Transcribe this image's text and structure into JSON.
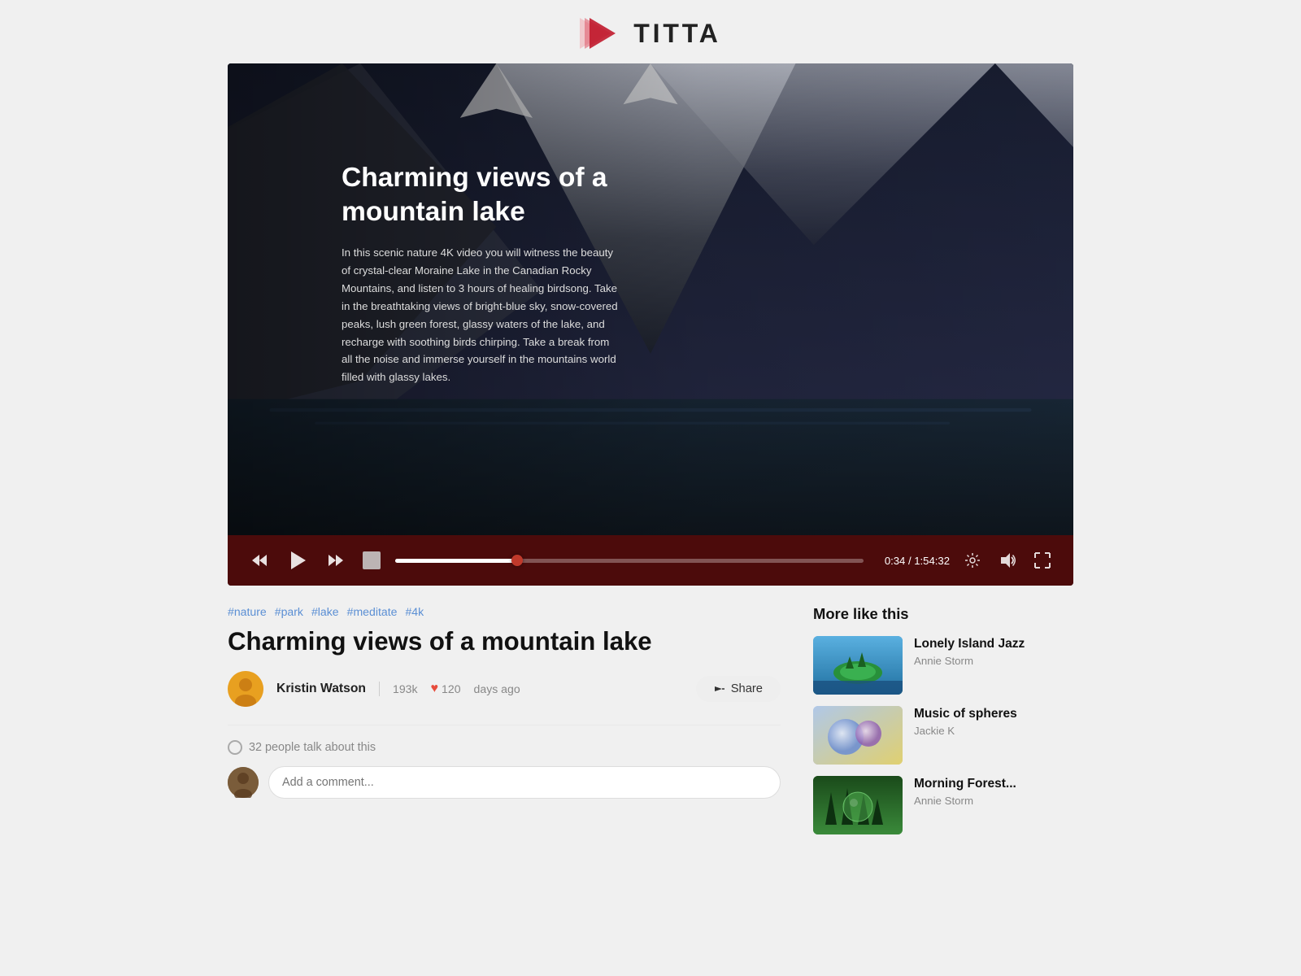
{
  "header": {
    "logo_text": "TITTA"
  },
  "player": {
    "title": "Charming views of a mountain lake",
    "description": "In this scenic nature 4K video you will witness the beauty of crystal-clear Moraine Lake in the Canadian Rocky Mountains, and listen to 3 hours of healing birdsong. Take in the breathtaking views of bright-blue sky, snow-covered peaks, lush green forest, glassy waters of the lake, and recharge with soothing birds chirping. Take a break from all the noise and immerse yourself in the mountains world filled with glassy lakes.",
    "current_time": "0:34",
    "total_time": "1:54:32",
    "time_display": "0:34 / 1:54:32",
    "progress_percent": 26
  },
  "video_meta": {
    "tags": [
      "#nature",
      "#park",
      "#lake",
      "#meditate",
      "#4k"
    ],
    "title": "Charming views of a mountain lake",
    "author": "Kristin Watson",
    "views": "193k",
    "likes": "120",
    "days_ago": "days ago",
    "share_label": "Share"
  },
  "comments": {
    "count_text": "32 people talk about this",
    "placeholder": "Add a comment..."
  },
  "sidebar": {
    "section_title": "More like this",
    "items": [
      {
        "title": "Lonely Island Jazz",
        "author": "Annie Storm",
        "thumb_type": "island"
      },
      {
        "title": "Music of spheres",
        "author": "Jackie K",
        "thumb_type": "spheres"
      },
      {
        "title": "Morning Forest...",
        "author": "Annie Storm",
        "thumb_type": "forest"
      }
    ]
  },
  "icons": {
    "rewind": "⏮",
    "play": "▶",
    "forward": "⏭",
    "settings": "⚙",
    "volume": "🔊",
    "fullscreen": "⤢",
    "share_arrow": "➤",
    "heart": "♥",
    "comment_bubble": "○"
  }
}
